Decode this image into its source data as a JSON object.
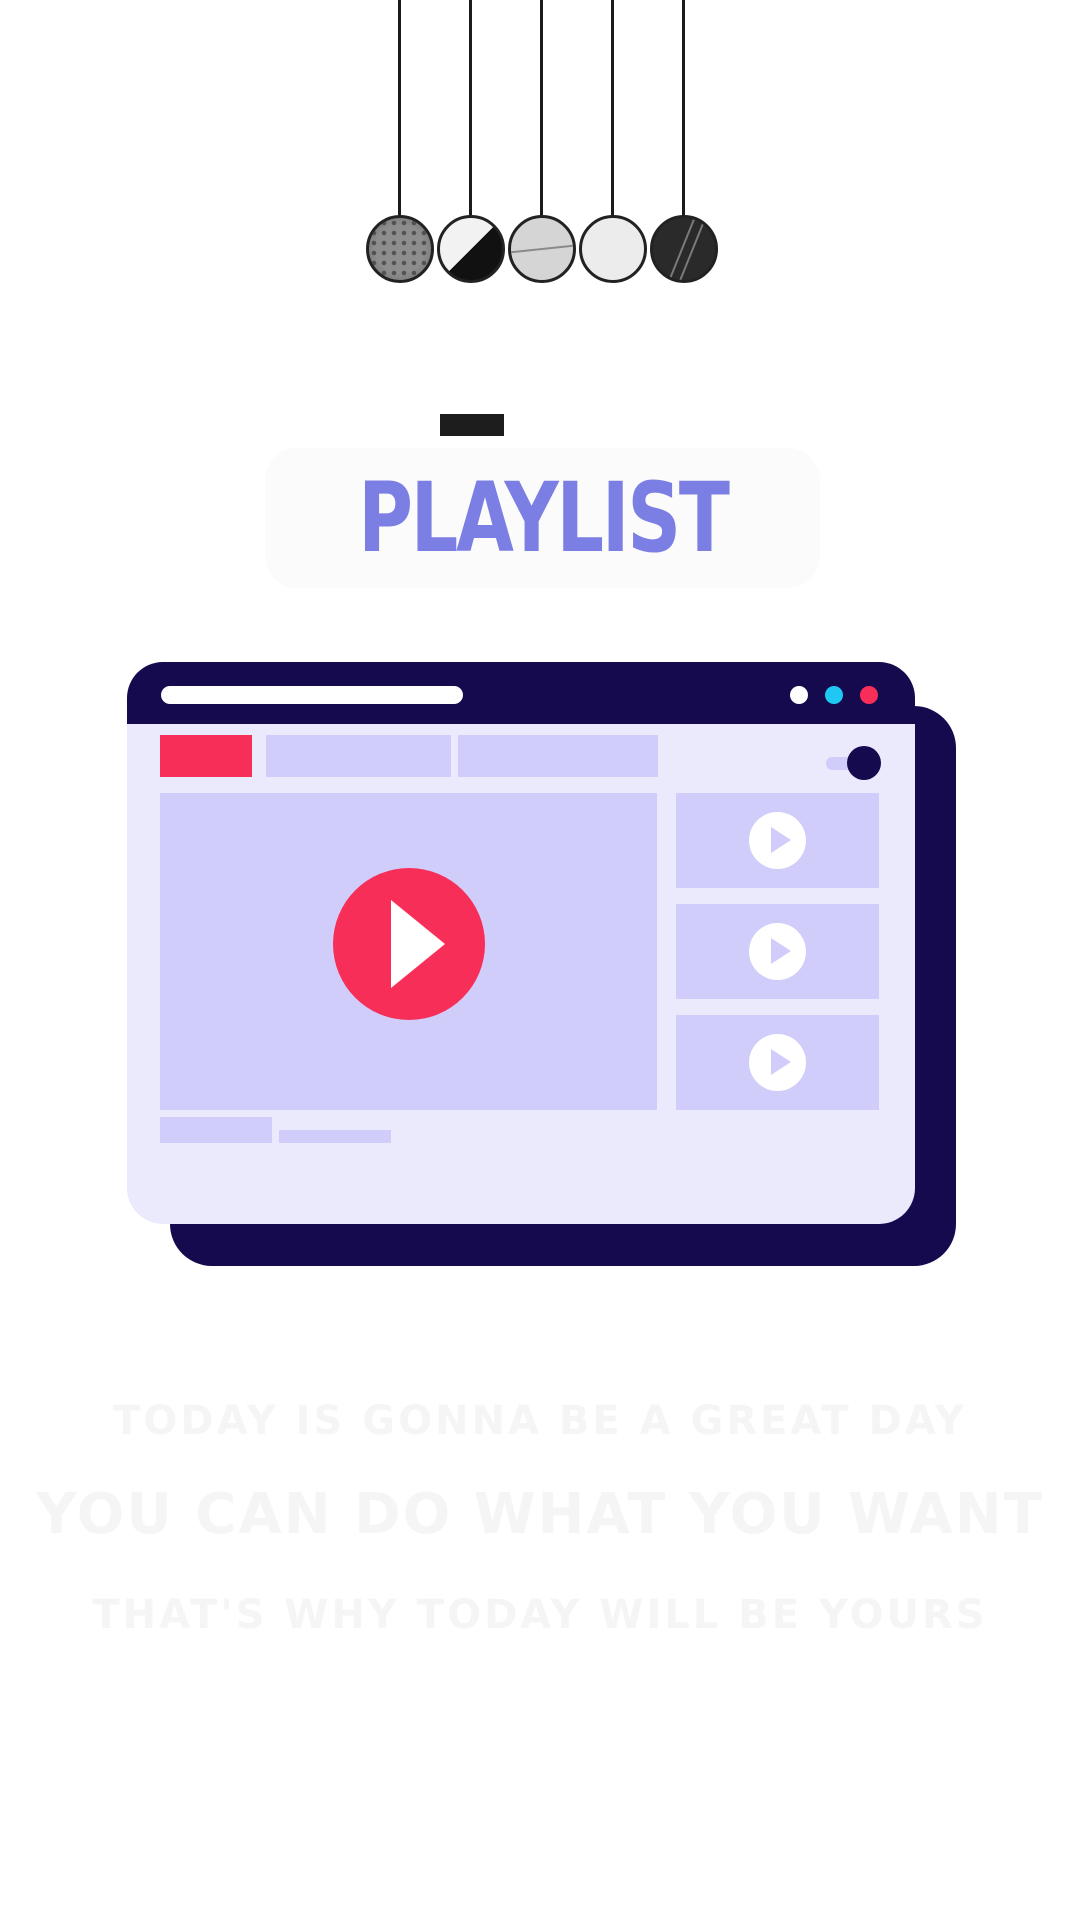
{
  "title": "PLAYLIST",
  "text_lines": [
    "TODAY IS GONNA BE A GREAT DAY",
    "YOU CAN DO WHAT YOU WANT",
    "THAT'S WHY TODAY WILL BE YOURS"
  ],
  "colors": {
    "accent": "#7b7fe4",
    "window_dark": "#160a4e",
    "window_bg": "#ebe9fc",
    "panel": "#d1cdfb",
    "play_red": "#f72e58",
    "dot_white": "#ffffff",
    "dot_cyan": "#1ec8f3",
    "dot_red": "#f72e58"
  },
  "playlist_items": 3
}
